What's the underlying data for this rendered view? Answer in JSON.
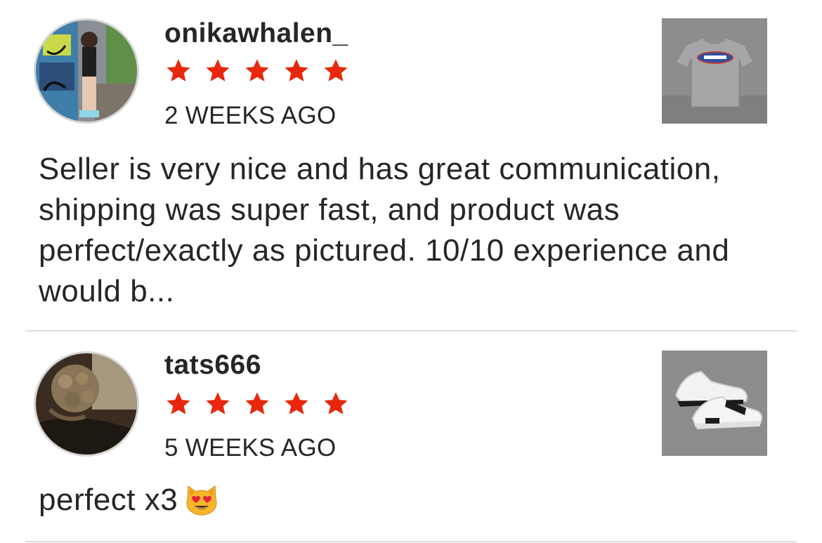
{
  "colors": {
    "star": "#e8270c",
    "text": "#262626",
    "divider": "#dcdcdc"
  },
  "reviews": [
    {
      "username": "onikawhalen_",
      "rating": 5,
      "timestamp": "2 WEEKS AGO",
      "text": "Seller is very nice and has great communication, shipping was super fast, and product was perfect/exactly as pictured. 10/10 experience and would b...",
      "avatar_icon": "user-avatar-photo",
      "thumbnail_icon": "grey-tshirt-product-photo"
    },
    {
      "username": "tats666",
      "rating": 5,
      "timestamp": "5 WEEKS AGO",
      "text": "perfect x3",
      "text_emoji": "heart-eyes-cat-emoji",
      "avatar_icon": "user-avatar-photo",
      "thumbnail_icon": "white-sneakers-product-photo"
    }
  ]
}
